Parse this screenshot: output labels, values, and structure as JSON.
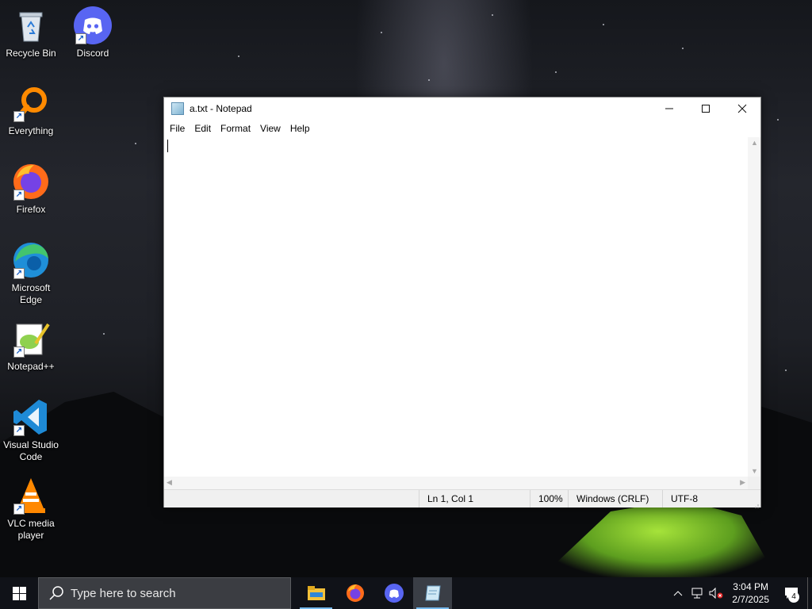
{
  "desktop": {
    "icons": [
      {
        "label": "Recycle Bin",
        "icon": "recycle-bin-icon"
      },
      {
        "label": "Discord",
        "icon": "discord-icon"
      },
      {
        "label": "Everything",
        "icon": "everything-search-icon"
      },
      {
        "label": "Firefox",
        "icon": "firefox-icon"
      },
      {
        "label": "Microsoft Edge",
        "icon": "edge-icon"
      },
      {
        "label": "Notepad++",
        "icon": "notepad-plus-plus-icon"
      },
      {
        "label": "Visual Studio Code",
        "icon": "vscode-icon"
      },
      {
        "label": "VLC media player",
        "icon": "vlc-icon"
      }
    ]
  },
  "notepad": {
    "title": "a.txt - Notepad",
    "menu": [
      "File",
      "Edit",
      "Format",
      "View",
      "Help"
    ],
    "content": "",
    "status": {
      "position": "Ln 1, Col 1",
      "zoom": "100%",
      "line_ending": "Windows (CRLF)",
      "encoding": "UTF-8"
    }
  },
  "taskbar": {
    "search_placeholder": "Type here to search",
    "pinned": [
      "file-explorer-icon",
      "firefox-icon",
      "discord-icon",
      "notepad-icon"
    ],
    "active_app": "notepad-icon",
    "clock": {
      "time": "3:04 PM",
      "date": "2/7/2025"
    },
    "notifications_count": "4"
  }
}
